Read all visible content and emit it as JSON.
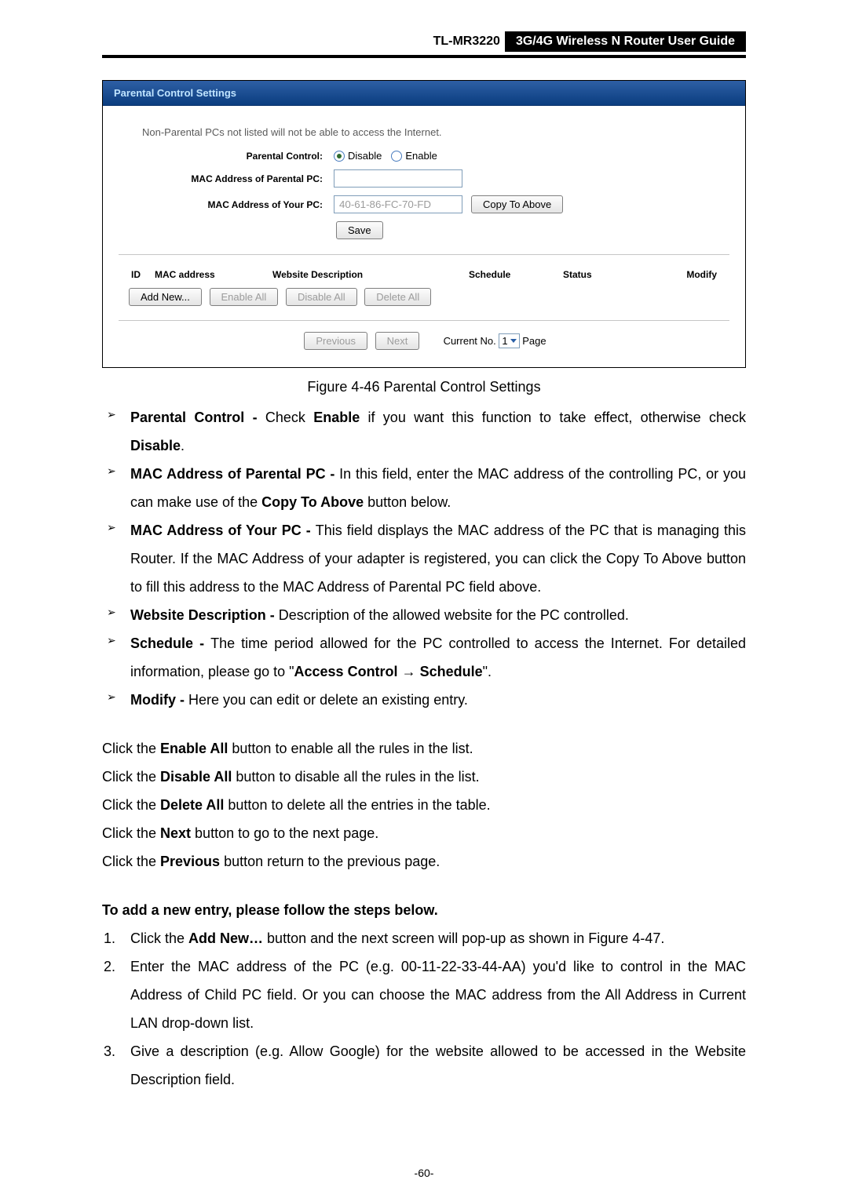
{
  "header": {
    "model": "TL-MR3220",
    "title": "3G/4G Wireless N Router User Guide"
  },
  "screenshot": {
    "panel_title": "Parental Control Settings",
    "note": "Non-Parental PCs not listed will not be able to access the Internet.",
    "labels": {
      "parental_control": "Parental Control:",
      "mac_parental": "MAC Address of Parental PC:",
      "mac_your": "MAC Address of Your PC:"
    },
    "radio": {
      "disable": "Disable",
      "enable": "Enable"
    },
    "inputs": {
      "mac_parental_value": "",
      "mac_your_value": "40-61-86-FC-70-FD"
    },
    "buttons": {
      "copy": "Copy To Above",
      "save": "Save",
      "addnew": "Add New...",
      "enableall": "Enable All",
      "disableall": "Disable All",
      "deleteall": "Delete All",
      "prev": "Previous",
      "next": "Next"
    },
    "table": {
      "id": "ID",
      "mac": "MAC address",
      "desc": "Website Description",
      "sched": "Schedule",
      "status": "Status",
      "modify": "Modify"
    },
    "pager": {
      "currentno": "Current No.",
      "value": "1",
      "page": "Page"
    }
  },
  "figcap": "Figure 4-46    Parental Control Settings",
  "bullets": [
    {
      "b": "Parental Control - ",
      "t": "Check ",
      "b2": "Enable",
      "t2": " if you want this function to take effect, otherwise check ",
      "b3": "Disable",
      "t3": "."
    },
    {
      "b": "MAC Address of Parental PC - ",
      "t": "In this field, enter the MAC address of the controlling PC, or you can make use of the ",
      "b2": "Copy To Above",
      "t2": " button below."
    },
    {
      "b": "MAC Address of Your PC - ",
      "t": "This field displays the MAC address of the PC that is managing this Router. If the MAC Address of your adapter is registered, you can click the Copy To Above button to fill this address to the MAC Address of Parental PC field above."
    },
    {
      "b": "Website Description - ",
      "t": "Description of the allowed website for the PC controlled."
    },
    {
      "b": "Schedule - ",
      "t": "The time period allowed for the PC controlled to access the Internet. For detailed information, please go to \"",
      "b2": "Access Control",
      "arrow": " → ",
      "b3": "Schedule",
      "t3": "\"."
    },
    {
      "b": "Modify - ",
      "t": "Here you can edit or delete an existing entry."
    }
  ],
  "plain": {
    "l1a": "Click the ",
    "l1b": "Enable All",
    "l1c": " button to enable all the rules in the list.",
    "l2a": "Click the ",
    "l2b": "Disable All",
    "l2c": " button to disable all the rules in the list.",
    "l3a": "Click the ",
    "l3b": "Delete All",
    "l3c": " button to delete all the entries in the table.",
    "l4a": "Click the ",
    "l4b": "Next",
    "l4c": " button to go to the next page.",
    "l5a": "Click the ",
    "l5b": "Previous",
    "l5c": " button return to the previous page."
  },
  "steps_title": "To add a new entry, please follow the steps below.",
  "steps": [
    {
      "a": "Click the ",
      "b": "Add New…",
      "c": " button and the next screen will pop-up as shown in Figure 4-47."
    },
    {
      "a": "Enter the MAC address of the PC (e.g. 00-11-22-33-44-AA) you'd like to control in the MAC Address of Child PC field. Or you can choose the MAC address from the All Address in Current LAN drop-down list."
    },
    {
      "a": "Give a description (e.g. Allow Google) for the website allowed to be accessed in the Website Description field."
    }
  ],
  "pageno": "-60-"
}
